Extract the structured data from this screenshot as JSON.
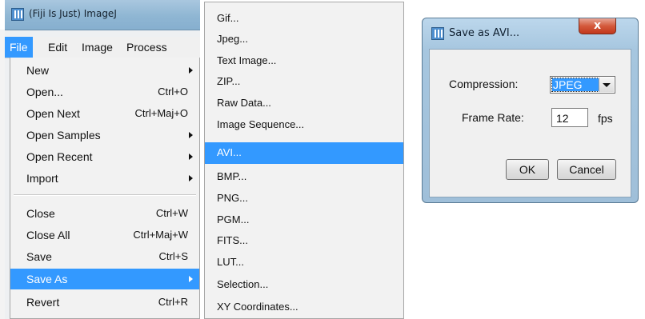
{
  "fiji_window": {
    "title": "(Fiji Is Just) ImageJ",
    "icon": "fiji-logo-icon"
  },
  "menubar": {
    "items": [
      {
        "label": "File",
        "active": true
      },
      {
        "label": "Edit"
      },
      {
        "label": "Image"
      },
      {
        "label": "Process"
      }
    ]
  },
  "file_menu": {
    "items": [
      {
        "label": "New",
        "shortcut": "",
        "submenu": true
      },
      {
        "label": "Open...",
        "shortcut": "Ctrl+O"
      },
      {
        "label": "Open Next",
        "shortcut": "Ctrl+Maj+O"
      },
      {
        "label": "Open Samples",
        "shortcut": "",
        "submenu": true
      },
      {
        "label": "Open Recent",
        "shortcut": "",
        "submenu": true
      },
      {
        "label": "Import",
        "shortcut": "",
        "submenu": true
      },
      {
        "label": "Close",
        "shortcut": "Ctrl+W"
      },
      {
        "label": "Close All",
        "shortcut": "Ctrl+Maj+W"
      },
      {
        "label": "Save",
        "shortcut": "Ctrl+S"
      },
      {
        "label": "Save As",
        "shortcut": "",
        "submenu": true,
        "selected": true
      },
      {
        "label": "Revert",
        "shortcut": "Ctrl+R"
      }
    ]
  },
  "saveas_submenu": {
    "items": [
      {
        "label": "Gif..."
      },
      {
        "label": "Jpeg..."
      },
      {
        "label": "Text Image..."
      },
      {
        "label": "ZIP..."
      },
      {
        "label": "Raw Data..."
      },
      {
        "label": "Image Sequence..."
      },
      {
        "label": "AVI...",
        "selected": true
      },
      {
        "label": "BMP..."
      },
      {
        "label": "PNG..."
      },
      {
        "label": "PGM..."
      },
      {
        "label": "FITS..."
      },
      {
        "label": "LUT..."
      },
      {
        "label": "Selection..."
      },
      {
        "label": "XY Coordinates..."
      }
    ]
  },
  "avi_dialog": {
    "title": "Save as AVI...",
    "close_label": "x",
    "compression_label": "Compression:",
    "compression_value": "JPEG",
    "frame_rate_label": "Frame Rate:",
    "frame_rate_value": "12",
    "frame_rate_unit": "fps",
    "ok_label": "OK",
    "cancel_label": "Cancel"
  },
  "colors": {
    "selection": "#3399ff",
    "menu_bg": "#f2f2f2",
    "titlebar": "#8fb6d3"
  }
}
